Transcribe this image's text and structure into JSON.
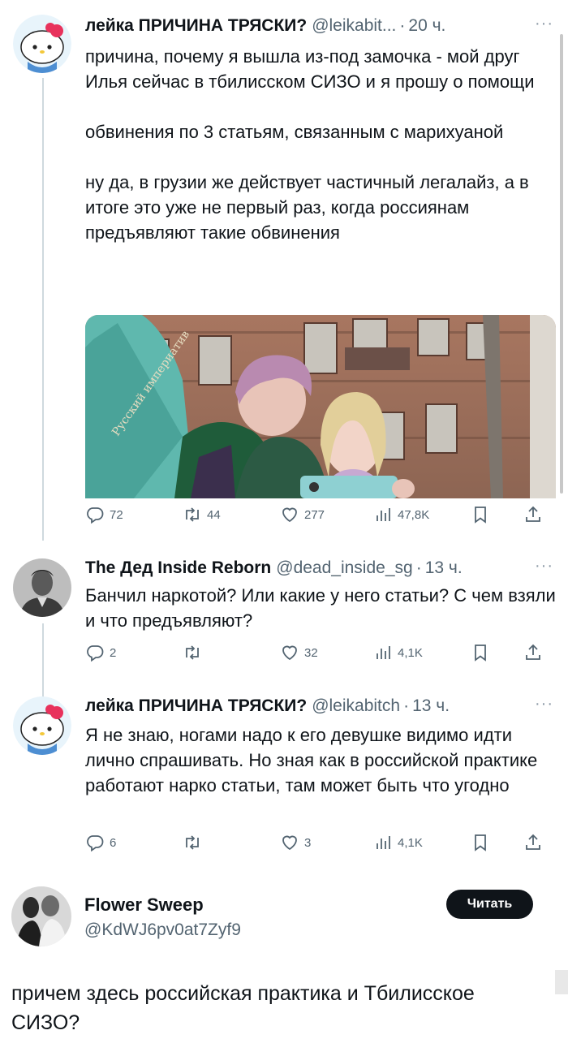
{
  "tweets": [
    {
      "name": "лейка ПРИЧИНА ТРЯСКИ?",
      "handle": "@leikabit...",
      "time": "20 ч.",
      "text": "причина, почему я вышла из-под замочка - мой друг Илья сейчас в тбилисском СИЗО и я прошу о помощи\n\nобвинения по 3 статьям, связанным с марихуаной\n\nну да, в грузии же действует частичный легалайз, а в итоге это уже не первый раз, когда россиянам предъявляют такие обвинения",
      "stats": {
        "replies": "72",
        "reposts": "44",
        "likes": "277",
        "views": "47,8K"
      }
    },
    {
      "name": "The Дед Inside Reborn",
      "handle": "@dead_inside_sg",
      "time": "13 ч.",
      "text": "Банчил наркотой? Или какие у него статьи? С чем взяли и что предъявляют?",
      "stats": {
        "replies": "2",
        "reposts": "",
        "likes": "32",
        "views": "4,1K"
      }
    },
    {
      "name": "лейка ПРИЧИНА ТРЯСКИ?",
      "handle": "@leikabitch",
      "time": "13 ч.",
      "text": "Я не знаю, ногами надо к его девушке видимо идти лично спрашивать. Но зная как в российской практике работают нарко статьи, там может быть что угодно",
      "stats": {
        "replies": "6",
        "reposts": "",
        "likes": "3",
        "views": "4,1K"
      }
    }
  ],
  "photo": {
    "book_text": "Русский империатив"
  },
  "suggested": {
    "name": "Flower Sweep",
    "handle": "@KdWJ6pv0at7Zyf9",
    "button": "Читать",
    "text": "причем здесь российская практика и Тбилисское СИЗО?"
  },
  "colors": {
    "text": "#0f1419",
    "secondary": "#536471",
    "thread_line": "#cfd9de",
    "button_bg": "#0f1419"
  },
  "icons": [
    "reply-icon",
    "repost-icon",
    "like-icon",
    "views-icon",
    "bookmark-icon",
    "share-icon",
    "more-icon"
  ]
}
